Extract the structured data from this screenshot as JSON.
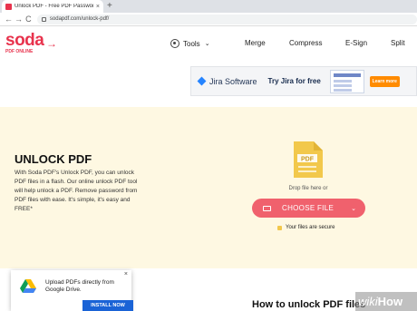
{
  "browser": {
    "tab_title": "Unlock PDF - Free PDF Passwor",
    "tab_close": "×",
    "new_tab": "+",
    "url": "sodapdf.com/unlock-pdf/",
    "back": "←",
    "forward": "→",
    "reload": "C"
  },
  "logo": {
    "word": "soda",
    "sub": "PDF ONLINE",
    "arrow": "→"
  },
  "nav": {
    "tools": "Tools",
    "chevron": "⌄",
    "items": [
      "Merge",
      "Compress",
      "E-Sign",
      "Split"
    ]
  },
  "ad": {
    "brand": "Jira Software",
    "cta": "Try Jira for free",
    "button": "Learn more",
    "colors": {
      "accent": "#2684ff",
      "button": "#ff8b00"
    }
  },
  "hero": {
    "title": "UNLOCK PDF",
    "description": "With Soda PDF's Unlock PDF, you can unlock PDF files in a flash. Our online unlock PDF tool will help unlock a PDF. Remove password from PDF files with ease. It's simple, it's easy and FREE*",
    "pdf_icon_label": "PDF",
    "drop_text": "Drop file here or",
    "choose_button": "CHOOSE FILE",
    "secure_text": "Your files are secure"
  },
  "popup": {
    "text": "Upload PDFs directly from Google Drive.",
    "button": "INSTALL NOW",
    "close": "×"
  },
  "section": {
    "heading": "How to unlock PDF files"
  },
  "watermark": {
    "wiki": "wiki",
    "how": "How"
  },
  "colors": {
    "brand": "#e8334d",
    "hero_bg": "#fef8e2",
    "choose_button": "#f0616d",
    "pdf_icon": "#f2c84b",
    "install_button": "#1a63d6"
  }
}
